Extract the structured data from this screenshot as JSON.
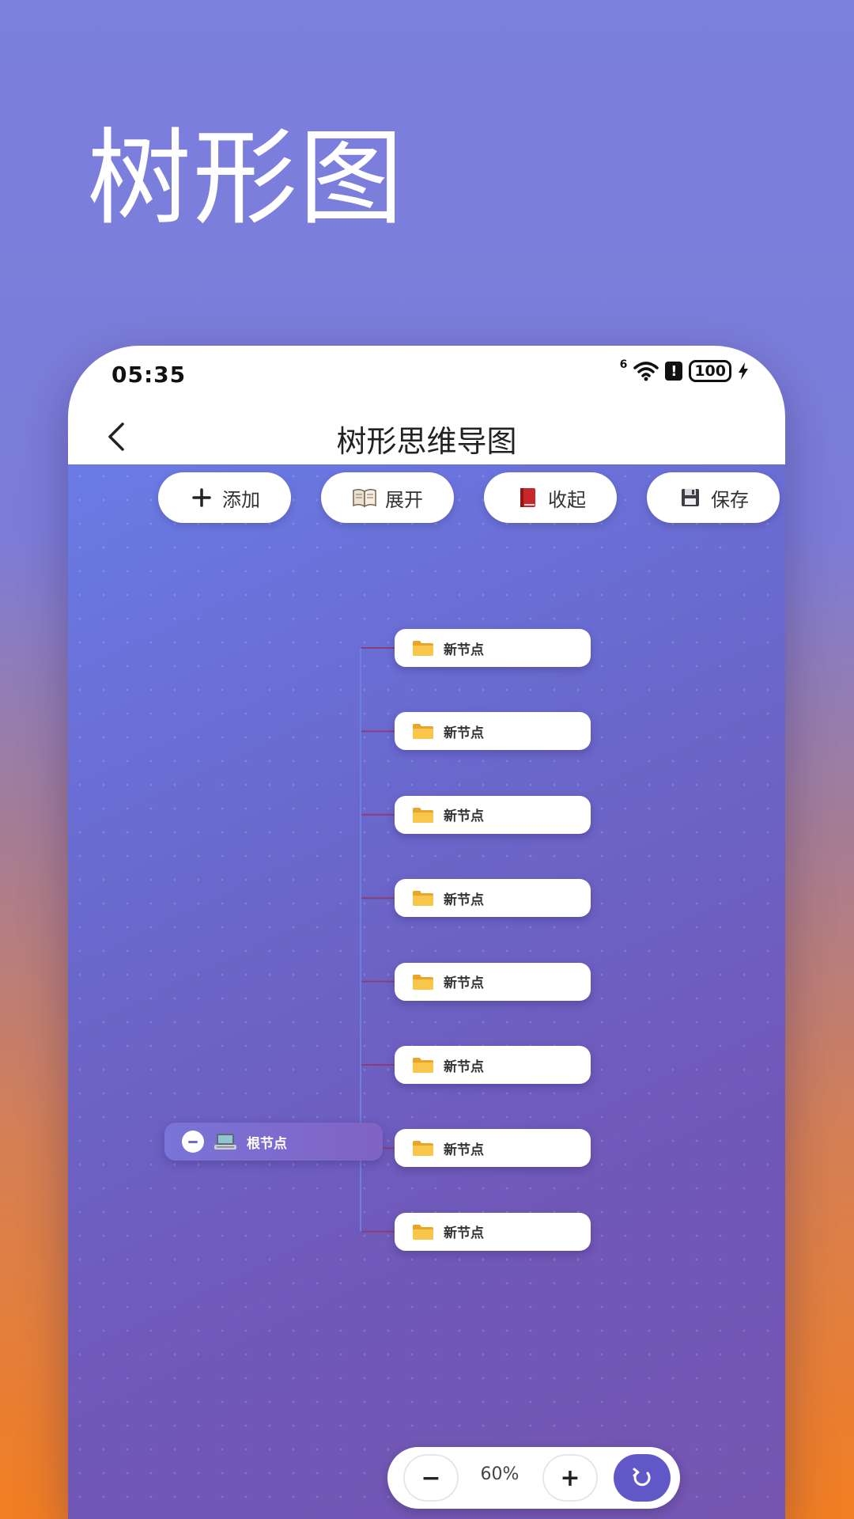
{
  "promo": {
    "title": "树形图"
  },
  "status_bar": {
    "time": "05:35",
    "signal_label": "6",
    "battery": "100"
  },
  "nav": {
    "title": "树形思维导图"
  },
  "toolbar": {
    "add_label": "添加",
    "expand_label": "展开",
    "collapse_label": "收起",
    "save_label": "保存"
  },
  "tree": {
    "root_label": "根节点",
    "children": [
      {
        "label": "新节点"
      },
      {
        "label": "新节点"
      },
      {
        "label": "新节点"
      },
      {
        "label": "新节点"
      },
      {
        "label": "新节点"
      },
      {
        "label": "新节点"
      },
      {
        "label": "新节点"
      },
      {
        "label": "新节点"
      }
    ]
  },
  "zoom": {
    "value": "60%",
    "minus_label": "−",
    "plus_label": "+"
  },
  "colors": {
    "accent": "#6158c8",
    "folder": "#f5b93a",
    "connector": "#8a3f7a"
  }
}
